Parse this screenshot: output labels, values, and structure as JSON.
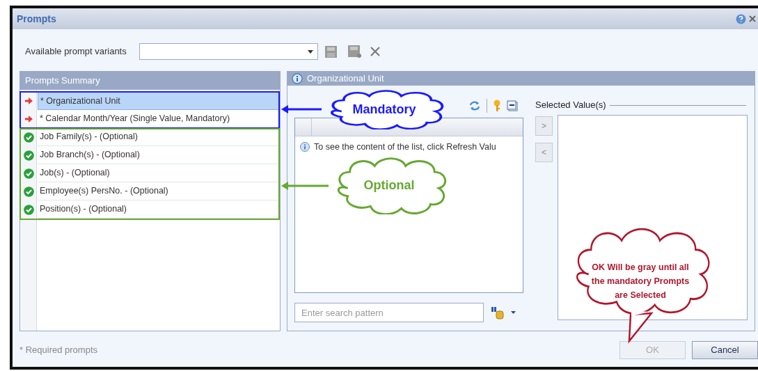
{
  "window": {
    "title": "Prompts"
  },
  "variants": {
    "label": "Available prompt variants"
  },
  "prompts_summary": {
    "title": "Prompts Summary",
    "items": [
      {
        "text": "* Organizational Unit",
        "kind": "mandatory",
        "selected": true
      },
      {
        "text": "* Calendar Month/Year (Single Value, Mandatory)",
        "kind": "mandatory",
        "selected": false
      },
      {
        "text": "Job Family(s) - (Optional)",
        "kind": "optional",
        "selected": false
      },
      {
        "text": "Job Branch(s) - (Optional)",
        "kind": "optional",
        "selected": false
      },
      {
        "text": "Job(s) - (Optional)",
        "kind": "optional",
        "selected": false
      },
      {
        "text": "Employee(s) PersNo. - (Optional)",
        "kind": "optional",
        "selected": false
      },
      {
        "text": "Position(s) - (Optional)",
        "kind": "optional",
        "selected": false
      }
    ]
  },
  "value_panel": {
    "title": "Organizational Unit",
    "info_text": "To see the content of the list, click Refresh Valu",
    "search": {
      "placeholder": "Enter search pattern"
    },
    "selected_label": "Selected Value(s)",
    "add_button": ">",
    "remove_button": "<"
  },
  "footer_note": "* Required prompts",
  "buttons": [
    {
      "label": "OK",
      "disabled": true
    },
    {
      "label": "Cancel",
      "disabled": false
    }
  ],
  "annotations": [
    {
      "kind": "mandatory",
      "text": "Mandatory",
      "color": "#1a1aff"
    },
    {
      "kind": "optional",
      "text": "Optional",
      "color": "#66a832"
    },
    {
      "kind": "note",
      "text": "OK Will be gray until all the mandatory Prompts are Selected",
      "color": "#b0182e"
    }
  ]
}
